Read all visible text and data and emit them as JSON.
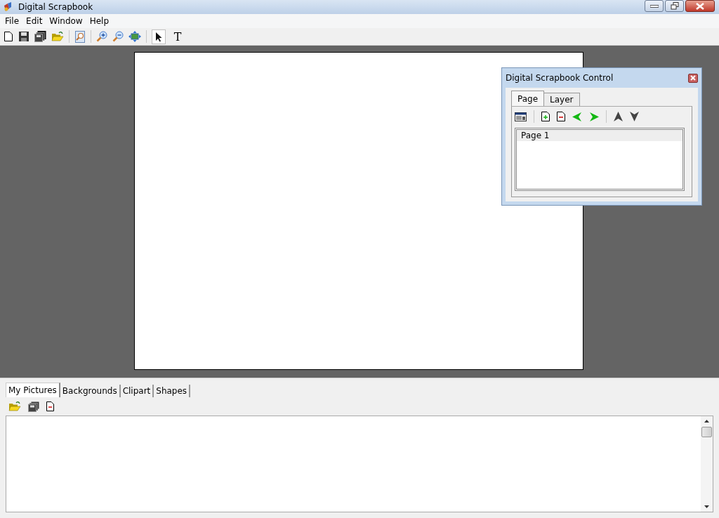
{
  "window": {
    "title": "Digital Scrapbook"
  },
  "menu": [
    "File",
    "Edit",
    "Window",
    "Help"
  ],
  "tools": [
    {
      "kind": "pointer",
      "selected": true
    },
    {
      "kind": "text",
      "label": "T",
      "selected": false
    }
  ],
  "control_panel": {
    "title": "Digital Scrapbook Control",
    "tabs": [
      {
        "label": "Page",
        "selected": true
      },
      {
        "label": "Layer",
        "selected": false
      }
    ],
    "pages": [
      {
        "label": "Page 1",
        "selected": true
      }
    ]
  },
  "library": {
    "tabs": [
      {
        "label": "My Pictures",
        "selected": true
      },
      {
        "label": "Backgrounds",
        "selected": false
      },
      {
        "label": "Clipart",
        "selected": false
      },
      {
        "label": "Shapes",
        "selected": false
      }
    ]
  }
}
